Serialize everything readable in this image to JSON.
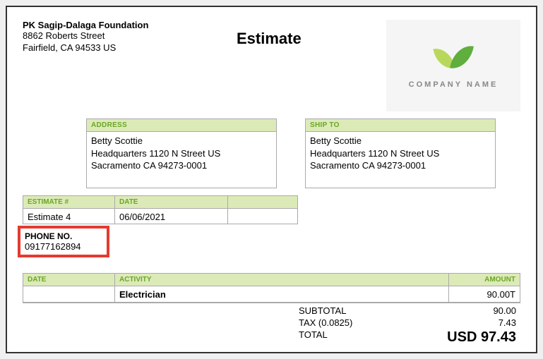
{
  "company": {
    "name": "PK Sagip-Dalaga Foundation",
    "street": "8862 Roberts Street",
    "city_line": "Fairfield, CA  94533 US"
  },
  "doc_title": "Estimate",
  "logo": {
    "text": "COMPANY NAME"
  },
  "address_block": {
    "header": "ADDRESS",
    "name": "Betty Scottie",
    "line1": "Headquarters 1120 N Street US",
    "line2": "Sacramento CA 94273-0001"
  },
  "shipto_block": {
    "header": "SHIP TO",
    "name": "Betty Scottie",
    "line1": "Headquarters 1120 N Street US",
    "line2": "Sacramento CA 94273-0001"
  },
  "estimate_section": {
    "col1_header": "ESTIMATE #",
    "col2_header": "DATE",
    "col1_value": "Estimate 4",
    "col2_value": "06/06/2021"
  },
  "phone": {
    "label": "PHONE NO.",
    "value": "09177162894"
  },
  "line_items": {
    "col_date": "DATE",
    "col_activity": "ACTIVITY",
    "col_amount": "AMOUNT",
    "rows": [
      {
        "date": "",
        "activity": "Electrician",
        "amount": "90.00T"
      }
    ]
  },
  "totals": {
    "subtotal_label": "SUBTOTAL",
    "subtotal_value": "90.00",
    "tax_label": "TAX (0.0825)",
    "tax_value": "7.43",
    "total_label": "TOTAL",
    "total_value": "USD 97.43"
  }
}
